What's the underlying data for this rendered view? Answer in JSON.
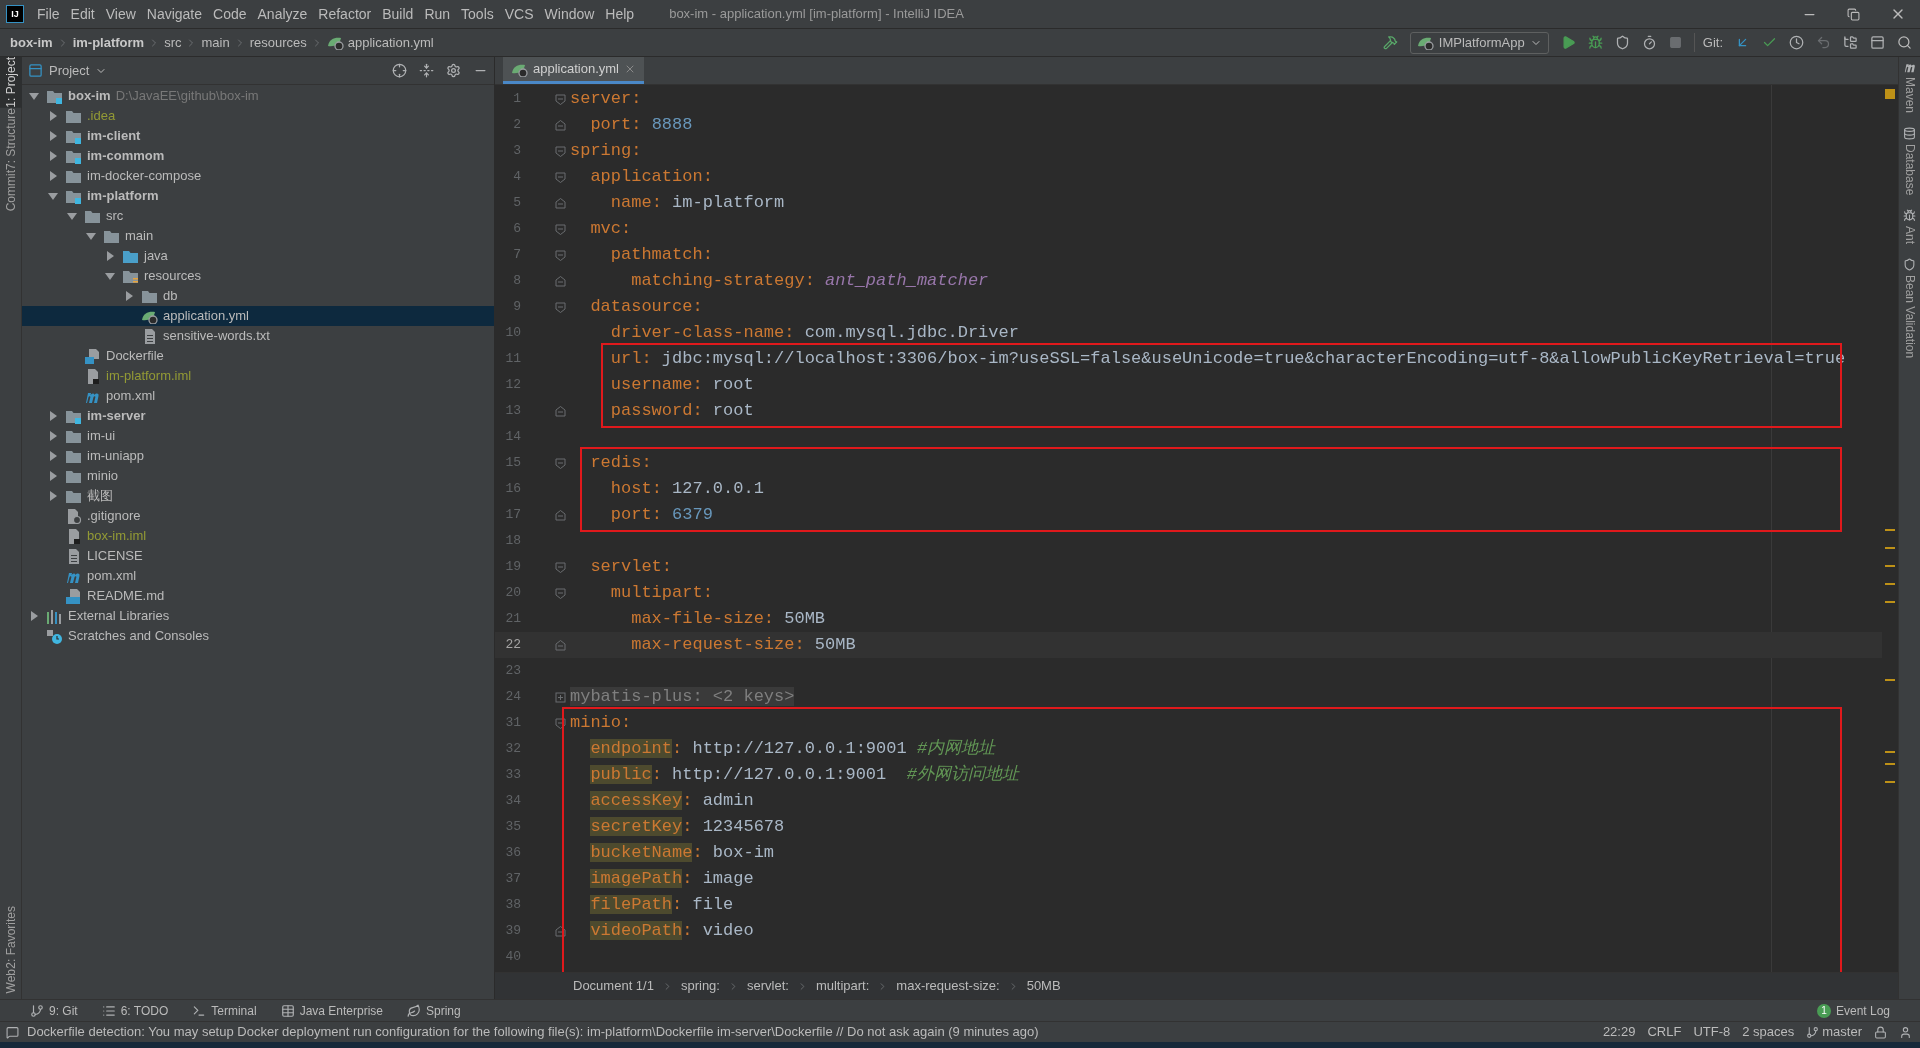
{
  "menu_bar": {
    "logo": "IJ",
    "items": [
      "File",
      "Edit",
      "View",
      "Navigate",
      "Code",
      "Analyze",
      "Refactor",
      "Build",
      "Run",
      "Tools",
      "VCS",
      "Window",
      "Help"
    ],
    "title": "box-im - application.yml [im-platform] - IntelliJ IDEA"
  },
  "nav_bar": {
    "breadcrumbs": [
      {
        "label": "box-im",
        "bold": true
      },
      {
        "label": "im-platform",
        "bold": true
      },
      {
        "label": "src",
        "bold": false
      },
      {
        "label": "main",
        "bold": false
      },
      {
        "label": "resources",
        "bold": false
      },
      {
        "label": "application.yml",
        "bold": false
      }
    ],
    "run_config": "IMPlatformApp",
    "git_label": "Git:"
  },
  "left_strip": {
    "top": [
      {
        "label": "1: Project",
        "selected": true
      },
      {
        "label": "7: Structure",
        "selected": false
      },
      {
        "label": "Commit",
        "selected": false
      }
    ],
    "bottom": [
      {
        "label": "2: Favorites"
      },
      {
        "label": "Web"
      }
    ]
  },
  "project_panel": {
    "title": "Project",
    "tree": [
      {
        "name": "box-im",
        "path": "D:\\JavaEE\\github\\box-im",
        "kind": "module",
        "bold": true,
        "ignored": false,
        "selected": false,
        "expanded": true,
        "children": [
          {
            "name": ".idea",
            "kind": "folder",
            "bold": false,
            "ignored": true,
            "selected": false,
            "expanded": false
          },
          {
            "name": "im-client",
            "kind": "module",
            "bold": true,
            "ignored": false,
            "selected": false,
            "expanded": false
          },
          {
            "name": "im-commom",
            "kind": "module",
            "bold": true,
            "ignored": false,
            "selected": false,
            "expanded": false
          },
          {
            "name": "im-docker-compose",
            "kind": "folder",
            "bold": false,
            "ignored": false,
            "selected": false,
            "expanded": false
          },
          {
            "name": "im-platform",
            "kind": "module",
            "bold": true,
            "ignored": false,
            "selected": false,
            "expanded": true,
            "children": [
              {
                "name": "src",
                "kind": "folder",
                "bold": false,
                "ignored": false,
                "selected": false,
                "expanded": true,
                "children": [
                  {
                    "name": "main",
                    "kind": "folder",
                    "bold": false,
                    "ignored": false,
                    "selected": false,
                    "expanded": true,
                    "children": [
                      {
                        "name": "java",
                        "kind": "source",
                        "bold": false,
                        "ignored": false,
                        "selected": false,
                        "expanded": false
                      },
                      {
                        "name": "resources",
                        "kind": "resources",
                        "bold": false,
                        "ignored": false,
                        "selected": false,
                        "expanded": true,
                        "children": [
                          {
                            "name": "db",
                            "kind": "folder",
                            "bold": false,
                            "ignored": false,
                            "selected": false,
                            "expanded": false
                          },
                          {
                            "name": "application.yml",
                            "kind": "yaml",
                            "bold": false,
                            "ignored": false,
                            "selected": true
                          },
                          {
                            "name": "sensitive-words.txt",
                            "kind": "text",
                            "bold": false,
                            "ignored": false,
                            "selected": false
                          }
                        ]
                      }
                    ]
                  }
                ]
              },
              {
                "name": "Dockerfile",
                "kind": "docker",
                "bold": false,
                "ignored": false,
                "selected": false
              },
              {
                "name": "im-platform.iml",
                "kind": "iml",
                "bold": false,
                "ignored": true,
                "selected": false
              },
              {
                "name": "pom.xml",
                "kind": "maven",
                "bold": false,
                "ignored": false,
                "selected": false
              }
            ]
          },
          {
            "name": "im-server",
            "kind": "module",
            "bold": true,
            "ignored": false,
            "selected": false,
            "expanded": false
          },
          {
            "name": "im-ui",
            "kind": "folder",
            "bold": false,
            "ignored": false,
            "selected": false,
            "expanded": false
          },
          {
            "name": "im-uniapp",
            "kind": "folder",
            "bold": false,
            "ignored": false,
            "selected": false,
            "expanded": false
          },
          {
            "name": "minio",
            "kind": "folder",
            "bold": false,
            "ignored": false,
            "selected": false,
            "expanded": false
          },
          {
            "name": "截图",
            "kind": "folder",
            "bold": false,
            "ignored": false,
            "selected": false,
            "expanded": false
          },
          {
            "name": ".gitignore",
            "kind": "gitignore",
            "bold": false,
            "ignored": false,
            "selected": false
          },
          {
            "name": "box-im.iml",
            "kind": "iml",
            "bold": false,
            "ignored": true,
            "selected": false
          },
          {
            "name": "LICENSE",
            "kind": "text",
            "bold": false,
            "ignored": false,
            "selected": false
          },
          {
            "name": "pom.xml",
            "kind": "maven",
            "bold": false,
            "ignored": false,
            "selected": false
          },
          {
            "name": "README.md",
            "kind": "markdown",
            "bold": false,
            "ignored": false,
            "selected": false
          }
        ]
      },
      {
        "name": "External Libraries",
        "kind": "libraries",
        "bold": false,
        "ignored": false,
        "selected": false,
        "expanded": false
      },
      {
        "name": "Scratches and Consoles",
        "kind": "scratches",
        "bold": false,
        "ignored": false,
        "selected": false
      }
    ]
  },
  "editor": {
    "tabs": [
      {
        "label": "application.yml",
        "selected": true
      }
    ],
    "blocks": [
      {
        "annotated": false,
        "lines": [
          {
            "number": "1",
            "kind": "fold-start",
            "current": false,
            "tokens": [
              {
                "kind": "key",
                "text": "server"
              },
              {
                "kind": "colon",
                "text": ":"
              }
            ]
          },
          {
            "number": "2",
            "kind": "fold-end",
            "current": false,
            "tokens": [
              {
                "kind": "key",
                "text": "  port"
              },
              {
                "kind": "colon",
                "text": ":"
              },
              {
                "kind": "number",
                "text": " 8888"
              }
            ]
          },
          {
            "number": "3",
            "kind": "fold-start",
            "current": false,
            "tokens": [
              {
                "kind": "key",
                "text": "spring"
              },
              {
                "kind": "colon",
                "text": ":"
              }
            ]
          },
          {
            "number": "4",
            "kind": "fold-start",
            "current": false,
            "tokens": [
              {
                "kind": "key",
                "text": "  application"
              },
              {
                "kind": "colon",
                "text": ":"
              }
            ]
          },
          {
            "number": "5",
            "kind": "fold-end",
            "current": false,
            "tokens": [
              {
                "kind": "key",
                "text": "    name"
              },
              {
                "kind": "colon",
                "text": ":"
              },
              {
                "kind": "plain",
                "text": " im-platform"
              }
            ]
          },
          {
            "number": "6",
            "kind": "fold-start",
            "current": false,
            "tokens": [
              {
                "kind": "key",
                "text": "  mvc"
              },
              {
                "kind": "colon",
                "text": ":"
              }
            ]
          },
          {
            "number": "7",
            "kind": "fold-start",
            "current": false,
            "tokens": [
              {
                "kind": "key",
                "text": "    pathmatch"
              },
              {
                "kind": "colon",
                "text": ":"
              }
            ]
          },
          {
            "number": "8",
            "kind": "fold-end",
            "current": false,
            "tokens": [
              {
                "kind": "key",
                "text": "      matching-strategy"
              },
              {
                "kind": "colon",
                "text": ":"
              },
              {
                "kind": "enum",
                "text": " ant_path_matcher"
              }
            ]
          },
          {
            "number": "9",
            "kind": "fold-start",
            "current": false,
            "tokens": [
              {
                "kind": "key",
                "text": "  datasource"
              },
              {
                "kind": "colon",
                "text": ":"
              }
            ]
          },
          {
            "number": "10",
            "kind": "plain",
            "current": false,
            "tokens": [
              {
                "kind": "key",
                "text": "    driver-class-name"
              },
              {
                "kind": "colon",
                "text": ":"
              },
              {
                "kind": "plain",
                "text": " com.mysql.jdbc.Driver"
              }
            ]
          }
        ]
      },
      {
        "annotated": true,
        "lines": [
          {
            "number": "11",
            "kind": "plain",
            "current": false,
            "tokens": [
              {
                "kind": "key",
                "text": "    url"
              },
              {
                "kind": "colon",
                "text": ":"
              },
              {
                "kind": "plain",
                "text": " jdbc:mysql://localhost:3306/box-im?useSSL=false&useUnicode=true&characterEncoding=utf-8&allowPublicKeyRetrieval=true"
              }
            ]
          },
          {
            "number": "12",
            "kind": "plain",
            "current": false,
            "tokens": [
              {
                "kind": "key",
                "text": "    username"
              },
              {
                "kind": "colon",
                "text": ":"
              },
              {
                "kind": "plain",
                "text": " root"
              }
            ]
          },
          {
            "number": "13",
            "kind": "fold-end",
            "current": false,
            "tokens": [
              {
                "kind": "key",
                "text": "    password"
              },
              {
                "kind": "colon",
                "text": ":"
              },
              {
                "kind": "plain",
                "text": " root"
              }
            ]
          }
        ]
      },
      {
        "annotated": false,
        "lines": [
          {
            "number": "14",
            "kind": "plain",
            "current": false
          }
        ]
      },
      {
        "annotated": true,
        "lines": [
          {
            "number": "15",
            "kind": "fold-start",
            "current": false,
            "tokens": [
              {
                "kind": "key",
                "text": "  redis"
              },
              {
                "kind": "colon",
                "text": ":"
              }
            ]
          },
          {
            "number": "16",
            "kind": "plain",
            "current": false,
            "tokens": [
              {
                "kind": "key",
                "text": "    host"
              },
              {
                "kind": "colon",
                "text": ":"
              },
              {
                "kind": "plain",
                "text": " 127.0.0.1"
              }
            ]
          },
          {
            "number": "17",
            "kind": "fold-end",
            "current": false,
            "tokens": [
              {
                "kind": "key",
                "text": "    port"
              },
              {
                "kind": "colon",
                "text": ":"
              },
              {
                "kind": "number",
                "text": " 6379"
              }
            ]
          }
        ]
      },
      {
        "annotated": false,
        "lines": [
          {
            "number": "18",
            "kind": "plain",
            "current": false
          },
          {
            "number": "19",
            "kind": "fold-start",
            "current": false,
            "tokens": [
              {
                "kind": "key",
                "text": "  servlet"
              },
              {
                "kind": "colon",
                "text": ":"
              }
            ]
          },
          {
            "number": "20",
            "kind": "fold-start",
            "current": false,
            "tokens": [
              {
                "kind": "key",
                "text": "    multipart"
              },
              {
                "kind": "colon",
                "text": ":"
              }
            ]
          },
          {
            "number": "21",
            "kind": "plain",
            "current": false,
            "tokens": [
              {
                "kind": "key",
                "text": "      max-file-size"
              },
              {
                "kind": "colon",
                "text": ":"
              },
              {
                "kind": "plain",
                "text": " 50MB"
              }
            ]
          },
          {
            "number": "22",
            "kind": "fold-end",
            "current": true,
            "tokens": [
              {
                "kind": "key",
                "text": "      max-request-size"
              },
              {
                "kind": "colon",
                "text": ":"
              },
              {
                "kind": "plain",
                "text": " 50MB"
              }
            ]
          },
          {
            "number": "23",
            "kind": "plain",
            "current": false
          },
          {
            "number": "24",
            "kind": "fold-collapsed",
            "current": false,
            "tokens": [
              {
                "kind": "folded",
                "text": "mybatis-plus: <2 keys>"
              }
            ]
          }
        ]
      },
      {
        "annotated": true,
        "lines": [
          {
            "number": "31",
            "kind": "fold-start",
            "current": false,
            "tokens": [
              {
                "kind": "key",
                "text": "minio"
              },
              {
                "kind": "colon",
                "text": ":"
              }
            ]
          },
          {
            "number": "32",
            "kind": "plain",
            "current": false,
            "tokens": [
              {
                "kind": "key-unused",
                "text": "  endpoint"
              },
              {
                "kind": "colon",
                "text": ":"
              },
              {
                "kind": "plain",
                "text": " http://127.0.0.1:9001 "
              },
              {
                "kind": "comment",
                "text": "#内网地址"
              }
            ]
          },
          {
            "number": "33",
            "kind": "plain",
            "current": false,
            "tokens": [
              {
                "kind": "key-unused",
                "text": "  public"
              },
              {
                "kind": "colon",
                "text": ":"
              },
              {
                "kind": "plain",
                "text": " http://127.0.0.1:9001  "
              },
              {
                "kind": "comment",
                "text": "#外网访问地址"
              }
            ]
          },
          {
            "number": "34",
            "kind": "plain",
            "current": false,
            "tokens": [
              {
                "kind": "key-unused",
                "text": "  accessKey"
              },
              {
                "kind": "colon",
                "text": ":"
              },
              {
                "kind": "plain",
                "text": " admin"
              }
            ]
          },
          {
            "number": "35",
            "kind": "plain",
            "current": false,
            "tokens": [
              {
                "kind": "key-unused",
                "text": "  secretKey"
              },
              {
                "kind": "colon",
                "text": ":"
              },
              {
                "kind": "plain",
                "text": " 12345678"
              }
            ]
          },
          {
            "number": "36",
            "kind": "plain",
            "current": false,
            "tokens": [
              {
                "kind": "key-unused",
                "text": "  bucketName"
              },
              {
                "kind": "colon",
                "text": ":"
              },
              {
                "kind": "plain",
                "text": " box-im"
              }
            ]
          },
          {
            "number": "37",
            "kind": "plain",
            "current": false,
            "tokens": [
              {
                "kind": "key-unused",
                "text": "  imagePath"
              },
              {
                "kind": "colon",
                "text": ":"
              },
              {
                "kind": "plain",
                "text": " image"
              }
            ]
          },
          {
            "number": "38",
            "kind": "plain",
            "current": false,
            "tokens": [
              {
                "kind": "key-unused",
                "text": "  filePath"
              },
              {
                "kind": "colon",
                "text": ":"
              },
              {
                "kind": "plain",
                "text": " file"
              }
            ]
          },
          {
            "number": "39",
            "kind": "fold-end",
            "current": false,
            "tokens": [
              {
                "kind": "key-unused",
                "text": "  videoPath"
              },
              {
                "kind": "colon",
                "text": ":"
              },
              {
                "kind": "plain",
                "text": " video"
              }
            ]
          },
          {
            "number": "40",
            "kind": "plain",
            "current": false
          }
        ]
      }
    ],
    "breadcrumbs": [
      "Document 1/1",
      "spring:",
      "servlet:",
      "multipart:",
      "max-request-size:",
      "50MB"
    ]
  },
  "right_strip": [
    {
      "label": "Maven",
      "kind": "maven"
    },
    {
      "label": "Database",
      "kind": "database"
    },
    {
      "label": "Ant",
      "kind": "ant"
    },
    {
      "label": "Bean Validation",
      "kind": "check"
    }
  ],
  "tool_tabs": [
    {
      "label": "9: Git",
      "kind": "git"
    },
    {
      "label": "6: TODO",
      "kind": "list"
    },
    {
      "label": "Terminal",
      "kind": "terminal"
    },
    {
      "label": "Java Enterprise",
      "kind": "table"
    },
    {
      "label": "Spring",
      "kind": "leaf"
    }
  ],
  "event_log": {
    "label": "Event Log",
    "count": "1"
  },
  "status_bar": {
    "message": "Dockerfile detection: You may setup Docker deployment run configuration for the following file(s): im-platform\\Dockerfile im-server\\Dockerfile // Do not ask again (9 minutes ago)",
    "items": [
      "22:29",
      "CRLF",
      "UTF-8",
      "2 spaces"
    ],
    "branch": "master"
  }
}
